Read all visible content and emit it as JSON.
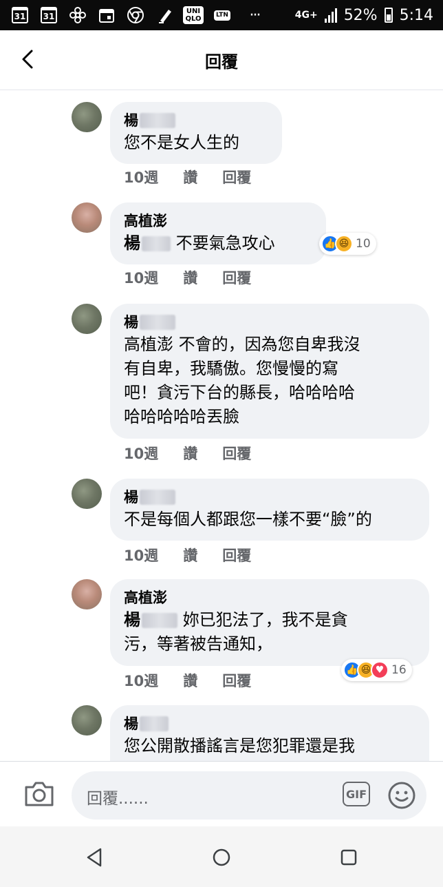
{
  "status": {
    "cal1": "31",
    "cal2": "31",
    "uniqlo": "UNI\nQLO",
    "ltn": "LTN",
    "dots": "···",
    "network": "4G+",
    "battery": "52%",
    "time": "5:14"
  },
  "header": {
    "title": "回覆"
  },
  "comments": [
    {
      "name": "楊",
      "text": "您不是女人生的",
      "time": "10週",
      "like_label": "讚",
      "reply_label": "回覆"
    },
    {
      "name": "高植澎",
      "mention": "楊",
      "text": " 不要氣急攻心",
      "time": "10週",
      "like_label": "讚",
      "reply_label": "回覆",
      "reaction_count": "10"
    },
    {
      "name": "楊",
      "text": "高植澎 不會的，因為您自卑我沒\n有自卑，我驕傲。您慢慢的寫\n吧！貪污下台的縣長，哈哈哈哈\n哈哈哈哈哈丟臉",
      "time": "10週",
      "like_label": "讚",
      "reply_label": "回覆"
    },
    {
      "name": "楊",
      "text": "不是每個人都跟您一樣不要“臉”的",
      "time": "10週",
      "like_label": "讚",
      "reply_label": "回覆"
    },
    {
      "name": "高植澎",
      "mention": "楊",
      "text": " 妳已犯法了，我不是貪\n污，等著被告通知，",
      "time": "10週",
      "like_label": "讚",
      "reply_label": "回覆",
      "reaction_count": "16"
    },
    {
      "name": "楊",
      "text": "您公開散播謠言是您犯罪還是我"
    }
  ],
  "composer": {
    "placeholder": "回覆......",
    "gif_label": "GIF"
  },
  "icons": {
    "back": "back-arrow-icon",
    "camera": "camera-icon",
    "gif": "gif-icon",
    "emoji": "emoji-icon",
    "nav_back": "nav-back-icon",
    "nav_home": "nav-home-icon",
    "nav_recents": "nav-recents-icon"
  },
  "colors": {
    "bubble": "#f0f2f5",
    "like": "#1877f2",
    "haha": "#f7b125",
    "love": "#f33e58",
    "meta": "#65676b"
  }
}
